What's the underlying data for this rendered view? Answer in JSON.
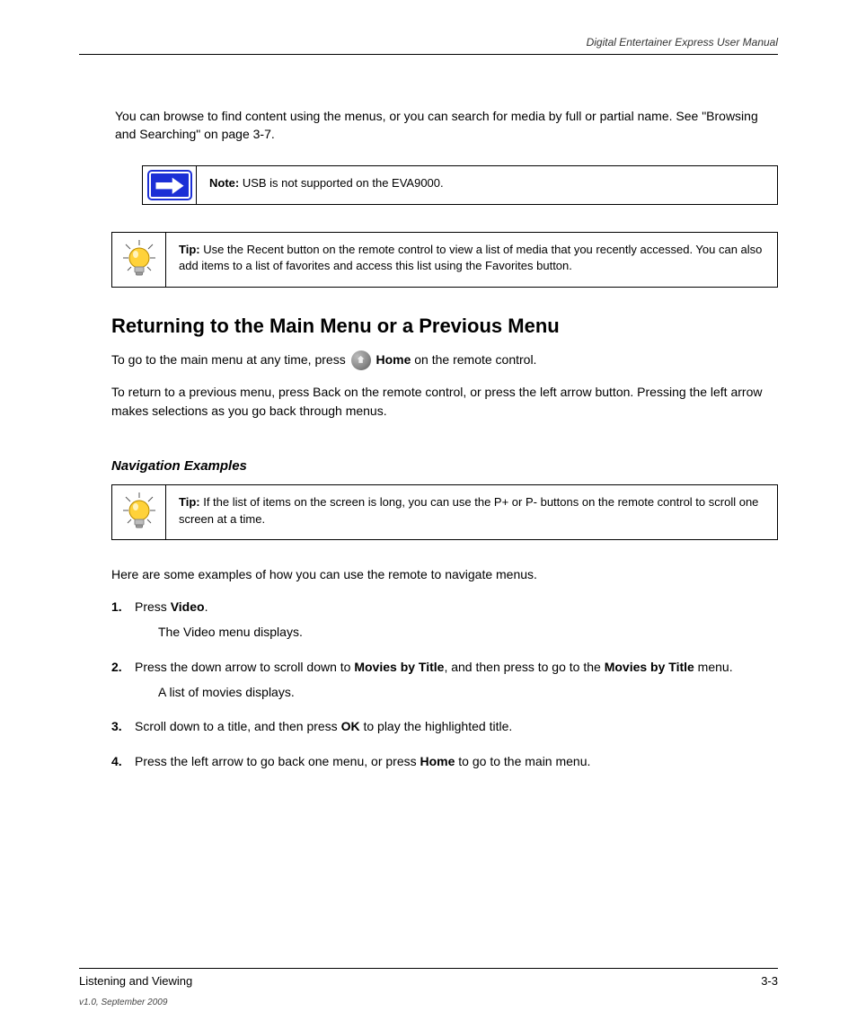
{
  "header": {
    "doc_title": "Digital Entertainer Express User Manual"
  },
  "intro_paragraph": "You can browse to find content using the menus, or you can search for media by full or partial name. See \"Browsing and Searching\" on page 3-7.",
  "note": {
    "lead": "Note:",
    "text": " USB is not supported on the EVA9000."
  },
  "tip1": {
    "lead": "Tip:",
    "text": " Use the Recent button on the remote control to view a list of media that you recently accessed. You can also add items to a list of favorites and access this list using the Favorites button."
  },
  "section_heading": "Returning to the Main Menu or a Previous Menu",
  "section_p1_a": "To go to the main menu at any time, press ",
  "section_p1_b": "Home",
  "section_p1_c": " on the remote control.",
  "section_p2": "To return to a previous menu, press Back on the remote control, or press the left arrow button. Pressing the left arrow makes selections as you go back through menus.",
  "sub_heading": "Navigation Examples",
  "tip2": {
    "lead": "Tip:",
    "text": " If the list of items on the screen is long, you can use the P+ or P- buttons on the remote control to scroll one screen at a time."
  },
  "steps_intro": "Here are some examples of how you can use the remote to navigate menus.",
  "steps": [
    {
      "num": "1.",
      "html": "Press <b>Video</b>.",
      "sub": "The Video menu displays."
    },
    {
      "num": "2.",
      "html": "Press the down arrow to scroll down to <b>Movies by Title</b>, and then press to go to the <b>Movies by Title</b> menu.",
      "sub": "A list of movies displays."
    },
    {
      "num": "3.",
      "html": "Scroll down to a title, and then press <b>OK</b> to play the highlighted title."
    },
    {
      "num": "4.",
      "html": "Press the left arrow to go back one menu, or press <b>Home</b> to go to the main menu."
    }
  ],
  "footer": {
    "section": "Listening and Viewing",
    "page": "3-3",
    "version": "v1.0, September 2009"
  }
}
